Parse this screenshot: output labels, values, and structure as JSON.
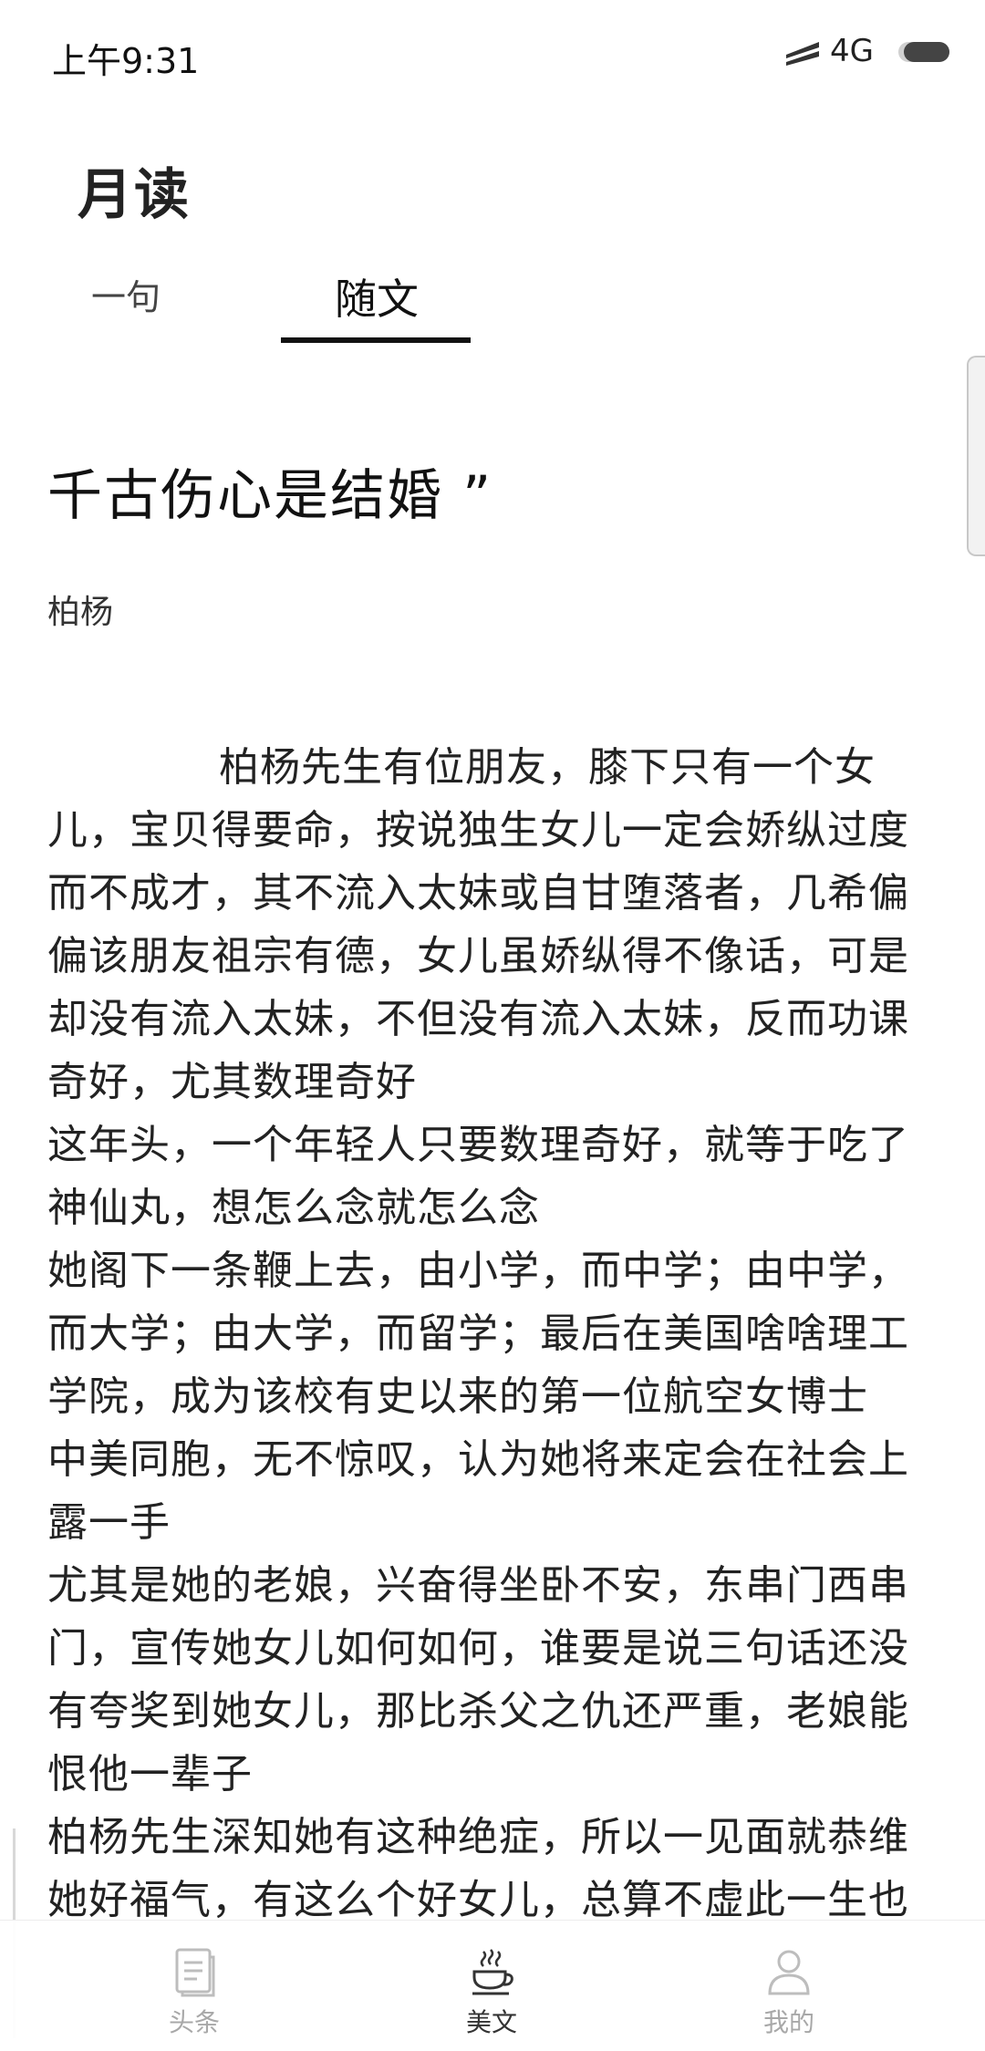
{
  "status_bar": {
    "time": "上午9:31",
    "network": "4G"
  },
  "header": {
    "app_title": "月读"
  },
  "tabs": [
    {
      "label": "一句",
      "active": false
    },
    {
      "label": "随文",
      "active": true
    }
  ],
  "article": {
    "title": "千古伤心是结婚 ”",
    "author": "柏杨",
    "paragraphs": [
      "柏杨先生有位朋友，膝下只有一个女儿，宝贝得要命，按说独生女儿一定会娇纵过度而不成才，其不流入太妹或自甘堕落者，几希偏偏该朋友祖宗有德，女儿虽娇纵得不像话，可是却没有流入太妹，不但没有流入太妹，反而功课奇好，尤其数理奇好",
      "这年头，一个年轻人只要数理奇好，就等于吃了神仙丸，想怎么念就怎么念",
      "她阁下一条鞭上去，由小学，而中学；由中学，而大学；由大学，而留学；最后在美国啥啥理工学院，成为该校有史以来的第一位航空女博士",
      "中美同胞，无不惊叹，认为她将来定会在社会上露一手",
      "尤其是她的老娘，兴奋得坐卧不安，东串门西串门，宣传她女儿如何如何，谁要是说三句话还没有夸奖到她女儿，那比杀父之仇还严重，老娘能恨他一辈子",
      "柏杨先生深知她有这种绝症，所以一见面就恭维她好福气，有这么个好女儿，总算不虚此一生也"
    ]
  },
  "bottom_nav": [
    {
      "label": "头条",
      "icon": "document-icon",
      "active": false
    },
    {
      "label": "美文",
      "icon": "coffee-cup-icon",
      "active": true
    },
    {
      "label": "我的",
      "icon": "person-icon",
      "active": false
    }
  ]
}
